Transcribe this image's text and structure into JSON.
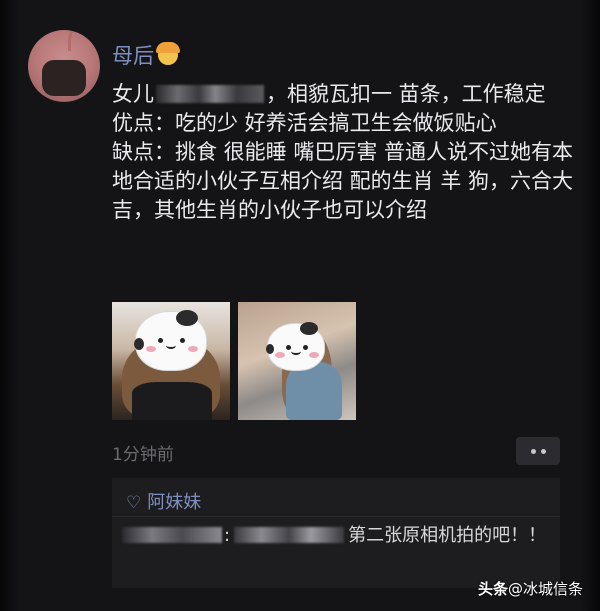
{
  "post": {
    "author": "母后",
    "author_emoji": "woman-emoji",
    "line1_prefix": "女儿",
    "line1_suffix": "，相貌瓦扣一 苗条，工作稳定",
    "line2": "优点：吃的少 好养活会搞卫生会做饭贴心",
    "line3": "缺点：挑食 很能睡 嘴巴厉害 普通人说不过她有本地合适的小伙子互相介绍 配的生肖 羊 狗，六合大吉，其他生肖的小伙子也可以介绍",
    "timestamp": "1分钟前"
  },
  "likes": {
    "names": "阿妹妹"
  },
  "comment": {
    "separator": ":",
    "text": "第二张原相机拍的吧！！"
  },
  "watermark": {
    "brand": "头条",
    "handle": "@冰城信条"
  },
  "colors": {
    "name_accent": "#7f8fbf",
    "background": "#141417"
  }
}
